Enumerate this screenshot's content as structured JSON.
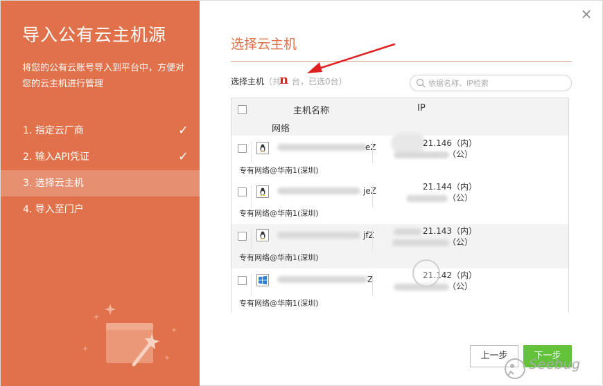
{
  "sidebar": {
    "title": "导入公有云主机源",
    "description": "将您的公有云账号导入到平台中，方便对您的云主机进行管理",
    "steps": [
      {
        "label": "1. 指定云厂商",
        "done": true
      },
      {
        "label": "2. 输入API凭证",
        "done": true
      },
      {
        "label": "3. 选择云主机",
        "active": true
      },
      {
        "label": "4. 导入至门户"
      }
    ],
    "check_glyph": "✓"
  },
  "close_glyph": "×",
  "main": {
    "title": "选择云主机",
    "select_label": "选择主机",
    "count_prefix": "（共",
    "count_suffix": "台，已选0台）",
    "search_placeholder": "依据名称、IP检索"
  },
  "annotation": {
    "mark": "n"
  },
  "table": {
    "headers": {
      "name": "主机名称",
      "ip": "IP",
      "network": "网络"
    },
    "rows": [
      {
        "os": "linux",
        "name_tail": "eZ",
        "ip_inner": "21.146（内）",
        "ip_public": "（公）",
        "network": "专有网络@华南1(深圳)"
      },
      {
        "os": "linux",
        "name_tail": "jeZ",
        "ip_inner": "21.144（内）",
        "ip_public": "（公）",
        "network": "专有网络@华南1(深圳)"
      },
      {
        "os": "linux",
        "name_tail": "jfZ",
        "ip_inner": "21.143（内）",
        "ip_public": "（公）",
        "network": "专有网络@华南1(深圳)"
      },
      {
        "os": "windows",
        "name_tail": "Z",
        "ip_inner": "21.142（内）",
        "ip_public": "（公）",
        "network": "专有网络@华南1(深圳)"
      }
    ]
  },
  "buttons": {
    "prev": "上一步",
    "next": "下一步"
  },
  "watermark": {
    "text": "Seebug"
  },
  "colors": {
    "accent": "#e1714a",
    "active_step": "#e68f70",
    "next_button": "#62c23a",
    "annotation": "#e02020"
  }
}
